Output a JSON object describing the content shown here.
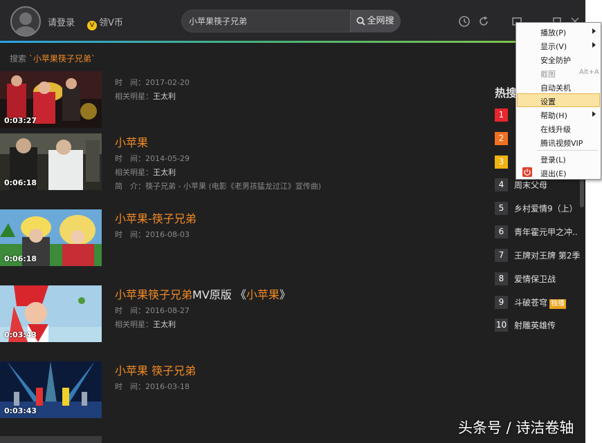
{
  "header": {
    "login": "请登录",
    "vcoin": "领V币",
    "vcoin_icon": "V",
    "search_value": "小苹果筷子兄弟",
    "search_button": "全网搜"
  },
  "breadcrumb": {
    "prefix": "搜索",
    "keyword": "`小苹果筷子兄弟`"
  },
  "results": [
    {
      "duration": "0:03:27",
      "title": "",
      "meta": [
        {
          "label": "时　间：",
          "value": "2017-02-20"
        },
        {
          "label": "相关明星：",
          "value": "王太利",
          "strong": true
        }
      ]
    },
    {
      "duration": "0:06:18",
      "title": "小苹果",
      "meta": [
        {
          "label": "时　间：",
          "value": "2014-05-29"
        },
        {
          "label": "相关明星：",
          "value": "王太利",
          "strong": true
        },
        {
          "label": "简　介：",
          "value": "筷子兄弟 - 小苹果 (电影《老男孩猛龙过江》宣传曲)"
        }
      ]
    },
    {
      "duration": "0:06:18",
      "title": "小苹果-筷子兄弟",
      "meta": [
        {
          "label": "时　间：",
          "value": "2016-08-03"
        }
      ]
    },
    {
      "duration": "0:03:43",
      "title_a": "小苹果筷子兄弟",
      "title_b": "MV原版 《",
      "title_c": "小苹果",
      "title_d": "》",
      "meta": [
        {
          "label": "时　间：",
          "value": "2016-08-27"
        },
        {
          "label": "相关明星：",
          "value": "王太利",
          "strong": true
        }
      ]
    },
    {
      "duration": "0:03:43",
      "title": "小苹果 筷子兄弟",
      "meta": [
        {
          "label": "时　间：",
          "value": "2016-03-18"
        }
      ]
    }
  ],
  "hot": {
    "title": "热搜",
    "items": [
      {
        "rank": "1",
        "name": "",
        "color": "#e8262d"
      },
      {
        "rank": "2",
        "name": "",
        "color": "#f3701f"
      },
      {
        "rank": "3",
        "name": "",
        "color": "#f1b311"
      },
      {
        "rank": "4",
        "name": "周末父母"
      },
      {
        "rank": "5",
        "name": "乡村爱情9（上）"
      },
      {
        "rank": "6",
        "name": "青年霍元甲之冲.."
      },
      {
        "rank": "7",
        "name": "王牌对王牌 第2季"
      },
      {
        "rank": "8",
        "name": "爱情保卫战"
      },
      {
        "rank": "9",
        "name": "斗破苍穹",
        "badge": "独播"
      },
      {
        "rank": "10",
        "name": "射雕英雄传"
      }
    ]
  },
  "menu": {
    "items": [
      {
        "label": "播放(P)",
        "submenu": true
      },
      {
        "label": "显示(V)",
        "submenu": true
      },
      {
        "label": "安全防护"
      },
      {
        "label": "截图",
        "accel": "Alt+A",
        "disabled": true
      },
      {
        "label": "自动关机"
      },
      {
        "label": "设置",
        "highlighted": true
      },
      {
        "label": "帮助(H)",
        "submenu": true
      },
      {
        "label": "在线升级"
      },
      {
        "label": "腾讯视频VIP"
      },
      {
        "label": "登录(L)"
      },
      {
        "label": "退出(E)"
      }
    ]
  },
  "watermark": "头条号 / 诗洁卷轴",
  "colors": {
    "accent": "#f08a24",
    "background": "#202021",
    "topbar": "#28282a",
    "menu_highlight": "#fbe3a3"
  }
}
